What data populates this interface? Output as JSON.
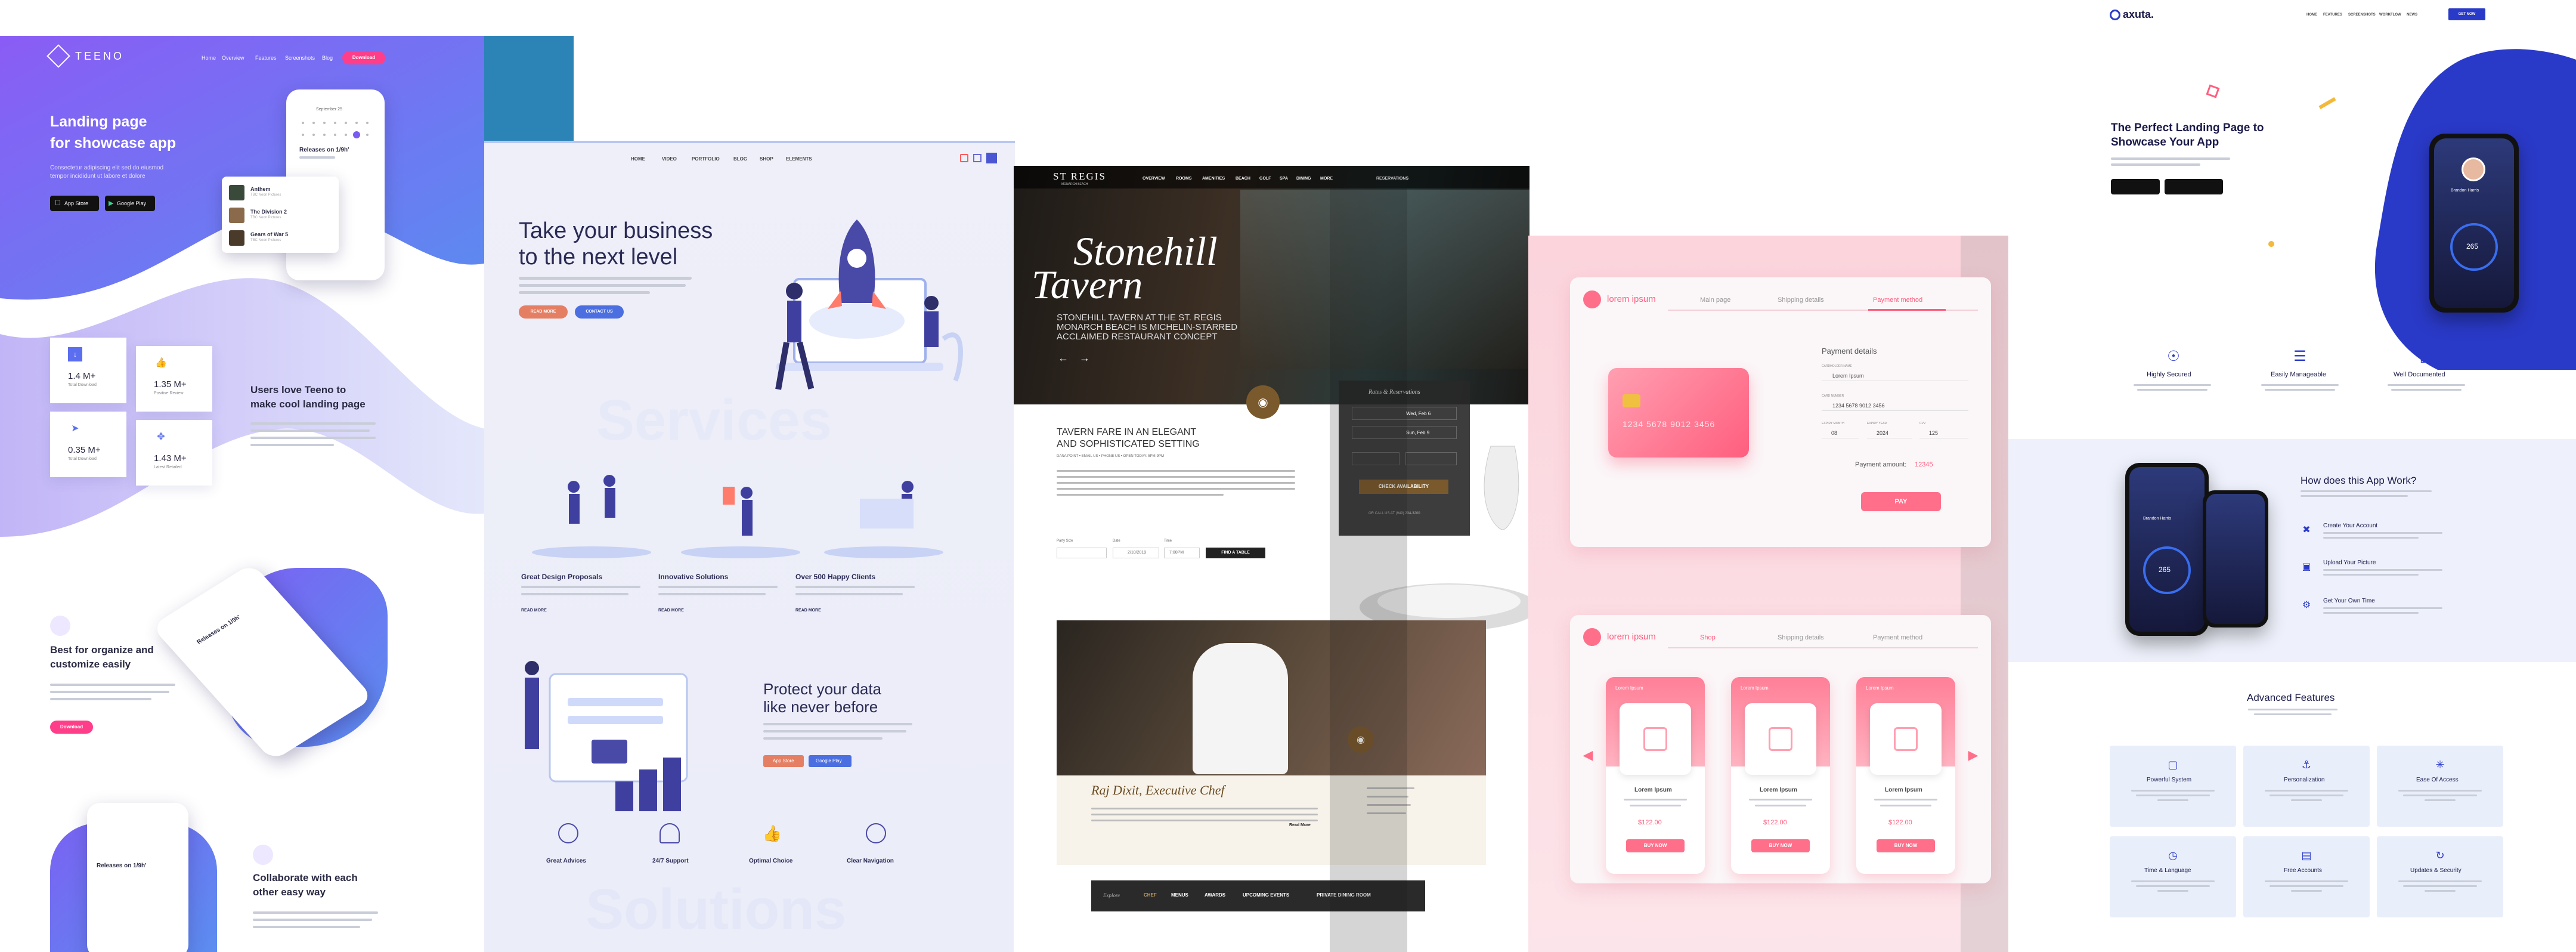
{
  "teeno": {
    "logo": "TEENO",
    "nav": [
      "Home",
      "Overview",
      "Features",
      "Screenshots",
      "Blog"
    ],
    "nav_cta": "Download",
    "hero_title_1": "Landing page",
    "hero_title_2": "for showcase app",
    "hero_desc_1": "Consectetur adipiscing elit sed do eiusmod",
    "hero_desc_2": "tempor incididunt ut labore et dolore",
    "app_store": "App Store",
    "google_play": "Google Play",
    "phone_date": "September 25",
    "phone_title": "Releases on 1/9h'",
    "list": [
      {
        "t": "Anthem",
        "s": "TBC Neon Pictures"
      },
      {
        "t": "The Division 2",
        "s": "TBC Neon Pictures"
      },
      {
        "t": "Gears of War 5",
        "s": "TBC Neon Pictures"
      }
    ],
    "stats": [
      {
        "v": "1.4 M+",
        "l": "Total Download"
      },
      {
        "v": "1.35 M+",
        "l": "Positive Review"
      },
      {
        "v": "0.35 M+",
        "l": "Total Download"
      },
      {
        "v": "1.43 M+",
        "l": "Latest Retailed"
      }
    ],
    "users_title_1": "Users love Teeno to",
    "users_title_2": "make cool landing page",
    "organize_title_1": "Best for organize and",
    "organize_title_2": "customize easily",
    "organize_btn": "Download",
    "phone2_title": "Releases on 1/9h'",
    "collab_title_1": "Collaborate with each",
    "collab_title_2": "other easy way"
  },
  "biz": {
    "nav": [
      "HOME",
      "VIDEO",
      "PORTFOLIO",
      "BLOG",
      "SHOP",
      "ELEMENTS"
    ],
    "hero_title_1": "Take your business",
    "hero_title_2": "to the next level",
    "btn_1": "READ MORE",
    "btn_2": "CONTACT US",
    "services_watermark": "Services",
    "services": [
      {
        "t": "Great Design Proposals",
        "r": "READ MORE"
      },
      {
        "t": "Innovative Solutions",
        "r": "READ MORE"
      },
      {
        "t": "Over 500 Happy Clients",
        "r": "READ MORE"
      }
    ],
    "protect_title_1": "Protect your data",
    "protect_title_2": "like never before",
    "app_store": "App Store",
    "google_play": "Google Play",
    "features": [
      "Great Advices",
      "24/7 Support",
      "Optimal Choice",
      "Clear Navigation"
    ],
    "solutions_watermark": "Solutions"
  },
  "stregis": {
    "logo": "ST REGIS",
    "logo_sub": "MONARCH BEACH",
    "nav": [
      "OVERVIEW",
      "ROOMS",
      "AMENITIES",
      "BEACH",
      "GOLF",
      "SPA",
      "DINING",
      "MORE"
    ],
    "nav_reserve": "RESERVATIONS",
    "hero_title_1": "Stonehill",
    "hero_title_2": "Tavern",
    "hero_sub_1": "STONEHILL TAVERN AT THE ST. REGIS",
    "hero_sub_2": "MONARCH BEACH IS MICHELIN-STARRED",
    "hero_sub_3": "ACCLAIMED RESTAURANT CONCEPT",
    "booking_title": "Rates & Reservations",
    "check_in": "Wed, Feb 6",
    "check_out": "Sun, Feb 9",
    "check_btn": "CHECK AVAILABILITY",
    "call": "OR CALL US AT (949) 234-3200",
    "section_title_1": "TAVERN FARE IN AN ELEGANT",
    "section_title_2": "AND SOPHISTICATED SETTING",
    "address": "DANA POINT • EMAIL US • PHONE US • OPEN TODAY: 5PM-9PM",
    "party_label": "Party Size",
    "date_label": "Date",
    "time_label": "Time",
    "date_val": "2/10/2019",
    "time_val": "7:00PM",
    "find_btn": "FIND A TABLE",
    "chef_title": "Raj Dixit, Executive Chef",
    "chef_read": "Read More",
    "footer_nav": [
      "Explore",
      "CHEF",
      "MENUS",
      "AWARDS",
      "UPCOMING EVENTS",
      "PRIVATE DINING ROOM"
    ]
  },
  "pay": {
    "logo": "lorem ipsum",
    "tabs": [
      "Main page",
      "Shipping details",
      "Payment method"
    ],
    "card_number": "1234 5678 9012 3456",
    "payment_title": "Payment details",
    "name_label": "CARDHOLDER NAME",
    "name_value": "Lorem Ipsum",
    "card_label": "CARD NUMBER",
    "card_value": "1234 5678 9012 3456",
    "exp_label": "EXPIRY MONTH",
    "year_label": "EXPIRY YEAR",
    "cvv_label": "CVV",
    "exp_value": "08",
    "year_value": "2024",
    "cvv_value": "125",
    "amount_label": "Payment amount:",
    "amount_value": "12345",
    "pay_btn": "PAY",
    "tabs2": [
      "Shop",
      "Shipping details",
      "Payment method"
    ],
    "products": [
      {
        "title": "Lorem Ipsum",
        "name": "Lorem Ipsum",
        "price": "$122.00",
        "btn": "BUY NOW"
      },
      {
        "title": "Lorem Ipsum",
        "name": "Lorem Ipsum",
        "price": "$122.00",
        "btn": "BUY NOW"
      },
      {
        "title": "Lorem Ipsum",
        "name": "Lorem Ipsum",
        "price": "$122.00",
        "btn": "BUY NOW"
      }
    ]
  },
  "axuta": {
    "logo": "axuta.",
    "nav": [
      "HOME",
      "FEATURES",
      "SCREENSHOTS",
      "WORKFLOW",
      "NEWS"
    ],
    "nav_cta": "GET NOW",
    "hero_title_1": "The Perfect Landing Page to",
    "hero_title_2": "Showcase Your App",
    "phone_name": "Brandon Harris",
    "phone_value": "265",
    "features": [
      "Highly Secured",
      "Easily Manageable",
      "Well Documented"
    ],
    "how_title": "How does this App Work?",
    "steps": [
      "Create Your Account",
      "Upload Your Picture",
      "Get Your Own Time"
    ],
    "phone2_name": "Brandon Harris",
    "phone2_value": "265",
    "adv_title": "Advanced Features",
    "adv_cards": [
      "Powerful System",
      "Personalization",
      "Ease Of Access",
      "Time & Language",
      "Free Accounts",
      "Updates & Security"
    ]
  }
}
